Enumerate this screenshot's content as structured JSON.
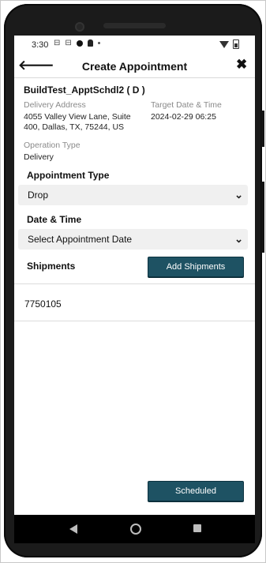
{
  "status_bar": {
    "time": "3:30",
    "icons": [
      "sim-icon",
      "sim-icon",
      "record-dot-icon",
      "key-icon",
      "small-dot-icon",
      "wifi-icon",
      "battery-icon"
    ]
  },
  "header": {
    "title": "Create Appointment",
    "back_icon": "arrow-left-icon",
    "close_icon": "close-icon"
  },
  "record": {
    "title": "BuildTest_ApptSchdl2 ( D )",
    "delivery_address_label": "Delivery Address",
    "delivery_address_line1": "4055 Valley View Lane, Suite",
    "delivery_address_line2": "400, Dallas, TX, 75244, US",
    "target_date_label": "Target Date & Time",
    "target_date_value": "2024-02-29 06:25",
    "operation_type_label": "Operation Type",
    "operation_type_value": "Delivery"
  },
  "appointment_type": {
    "label": "Appointment Type",
    "selected": "Drop"
  },
  "date_time": {
    "label": "Date & Time",
    "placeholder": "Select Appointment Date"
  },
  "shipments": {
    "label": "Shipments",
    "add_button": "Add Shipments",
    "items": [
      "7750105"
    ]
  },
  "footer": {
    "scheduled_button": "Scheduled"
  },
  "colors": {
    "primary_button": "#1e5263",
    "select_background": "#f0f0f0"
  }
}
